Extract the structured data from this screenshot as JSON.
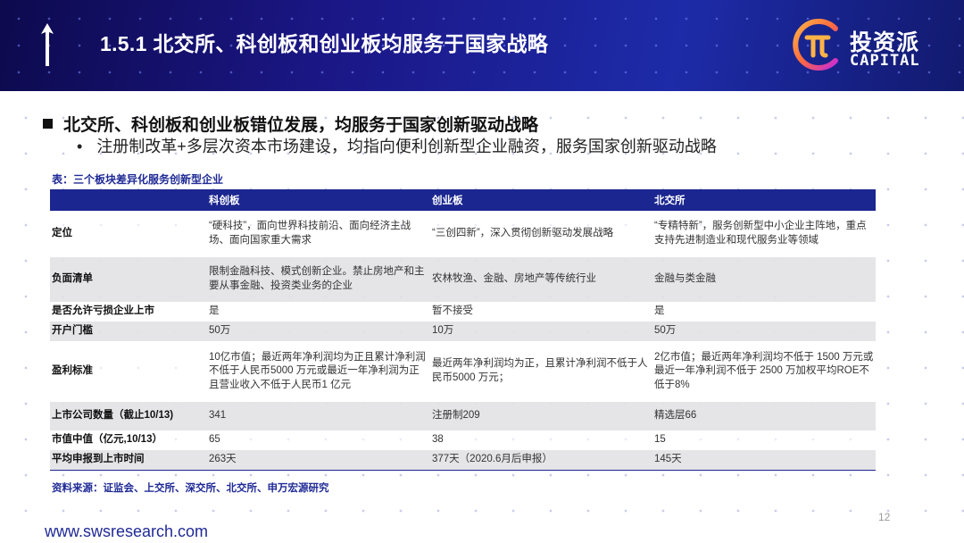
{
  "header": {
    "title": "1.5.1 北交所、科创板和创业板均服务于国家战略",
    "logo_cn": "投资派",
    "logo_en": "CAPITAL"
  },
  "bullets": {
    "main": "北交所、科创板和创业板错位发展，均服务于国家创新驱动战略",
    "sub_marker": "•",
    "sub": "注册制改革+多层次资本市场建设，均指向便利创新型企业融资，服务国家创新驱动战略"
  },
  "table": {
    "caption": "表：三个板块差异化服务创新型企业",
    "headers": [
      "",
      "科创板",
      "创业板",
      "北交所"
    ],
    "rows": [
      [
        "定位",
        "“硬科技”，面向世界科技前沿、面向经济主战场、面向国家重大需求",
        "“三创四新”，深入贯彻创新驱动发展战略",
        "“专精特新”，服务创新型中小企业主阵地，重点支持先进制造业和现代服务业等领域"
      ],
      [
        "负面清单",
        "限制金融科技、模式创新企业。禁止房地产和主要从事金融、投资类业务的企业",
        "农林牧渔、金融、房地产等传统行业",
        "金融与类金融"
      ],
      [
        "是否允许亏损企业上市",
        "是",
        "暂不接受",
        "是"
      ],
      [
        "开户门槛",
        "50万",
        "10万",
        "50万"
      ],
      [
        "盈利标准",
        "10亿市值；最近两年净利润均为正且累计净利润不低于人民币5000 万元或最近一年净利润为正且营业收入不低于人民币1 亿元",
        "最近两年净利润均为正，且累计净利润不低于人民币5000 万元；",
        "2亿市值；最近两年净利润均不低于 1500 万元或最近一年净利润不低于 2500 万加权平均ROE不低于8%"
      ],
      [
        "上市公司数量（截止10/13)",
        "341",
        "注册制209",
        "精选层66"
      ],
      [
        "市值中值（亿元,10/13）",
        "65",
        "38",
        "15"
      ],
      [
        "平均申报到上市时间",
        "263天",
        "377天（2020.6月后申报）",
        "145天"
      ]
    ]
  },
  "source": "资料来源：证监会、上交所、深交所、北交所、申万宏源研究",
  "page_number": "12",
  "website": "www.swsresearch.com"
}
